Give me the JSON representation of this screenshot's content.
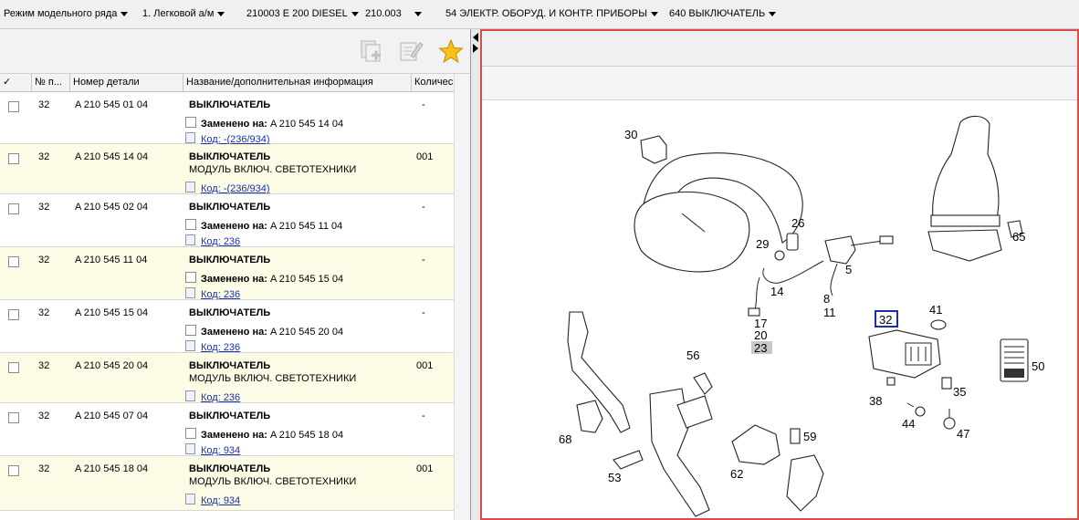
{
  "breadcrumb": [
    {
      "label": "Режим модельного ряда"
    },
    {
      "label": "1. Легковой а/м"
    },
    {
      "label": "210003 E 200 DIESEL"
    },
    {
      "label": "210.003"
    },
    {
      "label": "54 ЭЛЕКТР. ОБОРУД. И КОНТР. ПРИБОРЫ"
    },
    {
      "label": "640 ВЫКЛЮЧАТЕЛЬ"
    }
  ],
  "toolbar": {
    "icons": [
      "copy-add-icon",
      "edit-note-icon",
      "favorite-star-icon"
    ]
  },
  "table": {
    "headers": {
      "check": "✓",
      "pos": "№ п...",
      "part_number": "Номер детали",
      "name": "Название/дополнительная информация",
      "qty": "Количес"
    },
    "rows": [
      {
        "pos": "32",
        "part": "A 210 545 01 04",
        "name": "ВЫКЛЮЧАТЕЛЬ",
        "info_label": "Заменено на:",
        "info_value": "A 210 545 14 04",
        "code": "Код: -(236/934)",
        "qty": "-"
      },
      {
        "pos": "32",
        "part": "A 210 545 14 04",
        "name": "ВЫКЛЮЧАТЕЛЬ",
        "info_label": "",
        "info_value": "МОДУЛЬ ВКЛЮЧ. СВЕТОТЕХНИКИ",
        "code": "Код: -(236/934)",
        "qty": "001"
      },
      {
        "pos": "32",
        "part": "A 210 545 02 04",
        "name": "ВЫКЛЮЧАТЕЛЬ",
        "info_label": "Заменено на:",
        "info_value": "A 210 545 11 04",
        "code": "Код: 236",
        "qty": "-"
      },
      {
        "pos": "32",
        "part": "A 210 545 11 04",
        "name": "ВЫКЛЮЧАТЕЛЬ",
        "info_label": "Заменено на:",
        "info_value": "A 210 545 15 04",
        "code": "Код: 236",
        "qty": "-"
      },
      {
        "pos": "32",
        "part": "A 210 545 15 04",
        "name": "ВЫКЛЮЧАТЕЛЬ",
        "info_label": "Заменено на:",
        "info_value": "A 210 545 20 04",
        "code": "Код: 236",
        "qty": "-"
      },
      {
        "pos": "32",
        "part": "A 210 545 20 04",
        "name": "ВЫКЛЮЧАТЕЛЬ",
        "info_label": "",
        "info_value": "МОДУЛЬ ВКЛЮЧ. СВЕТОТЕХНИКИ",
        "code": "Код: 236",
        "qty": "001"
      },
      {
        "pos": "32",
        "part": "A 210 545 07 04",
        "name": "ВЫКЛЮЧАТЕЛЬ",
        "info_label": "Заменено на:",
        "info_value": "A 210 545 18 04",
        "code": "Код: 934",
        "qty": "-"
      },
      {
        "pos": "32",
        "part": "A 210 545 18 04",
        "name": "ВЫКЛЮЧАТЕЛЬ",
        "info_label": "",
        "info_value": "МОДУЛЬ ВКЛЮЧ. СВЕТОТЕХНИКИ",
        "code": "Код: 934",
        "qty": "001"
      }
    ]
  },
  "diagram": {
    "labels": [
      "30",
      "26",
      "29",
      "5",
      "14",
      "8",
      "11",
      "17",
      "20",
      "23",
      "65",
      "32",
      "41",
      "50",
      "56",
      "35",
      "38",
      "44",
      "47",
      "68",
      "59",
      "53",
      "62"
    ],
    "selected_label": "32",
    "grey_label": "23"
  },
  "colors": {
    "accent_border": "#e04a4a",
    "row_alt": "#fbfbe6",
    "link": "#1a2fb0",
    "highlight_box": "#1c2fa8"
  }
}
